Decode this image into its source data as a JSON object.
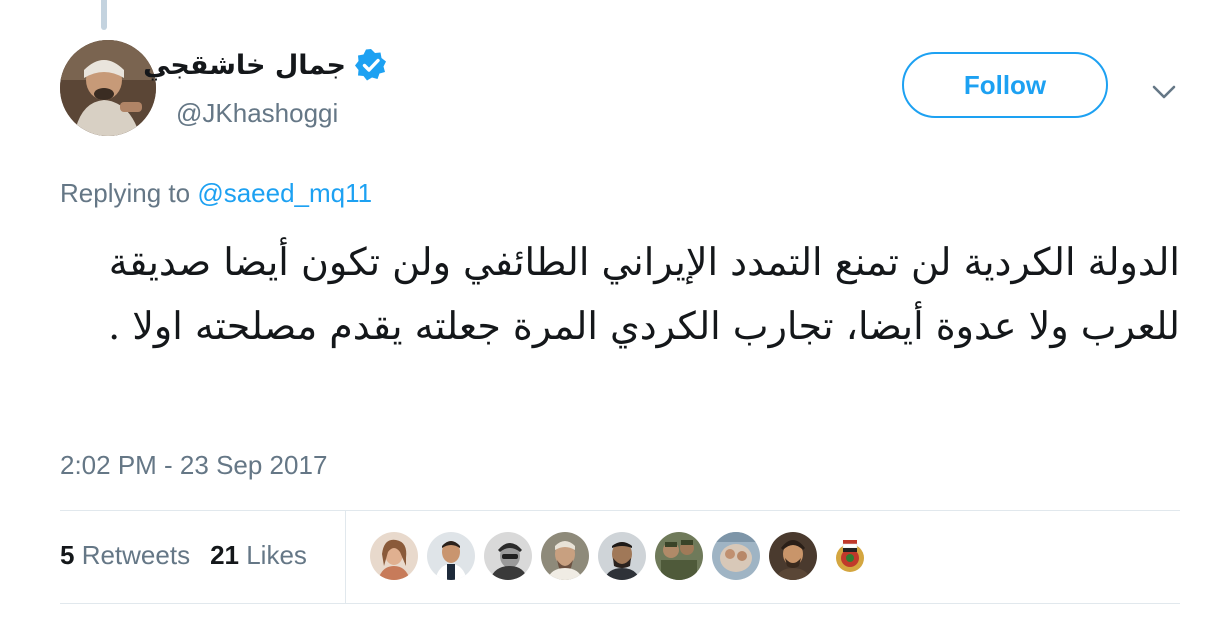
{
  "tweet": {
    "author": {
      "display_name": "جمال خاشقجي",
      "handle": "@JKhashoggi",
      "verified": true
    },
    "follow_label": "Follow",
    "replying_prefix": "Replying to ",
    "replying_to": "@saeed_mq11",
    "text": "الدولة الكردية لن تمنع التمدد الإيراني الطائفي ولن تكون أيضا صديقة للعرب ولا عدوة أيضا، تجارب الكردي المرة جعلته يقدم مصلحته اولا .",
    "timestamp": "2:02 PM - 23 Sep 2017",
    "stats": {
      "retweets_count": "5",
      "retweets_label": " Retweets",
      "likes_count": "21",
      "likes_label": " Likes"
    }
  },
  "colors": {
    "accent": "#1da1f2",
    "secondary_text": "#657786",
    "primary_text": "#14171a",
    "divider": "#e1e8ed"
  },
  "icons": {
    "verified": "verified-badge-icon",
    "chevron": "chevron-down-icon"
  }
}
